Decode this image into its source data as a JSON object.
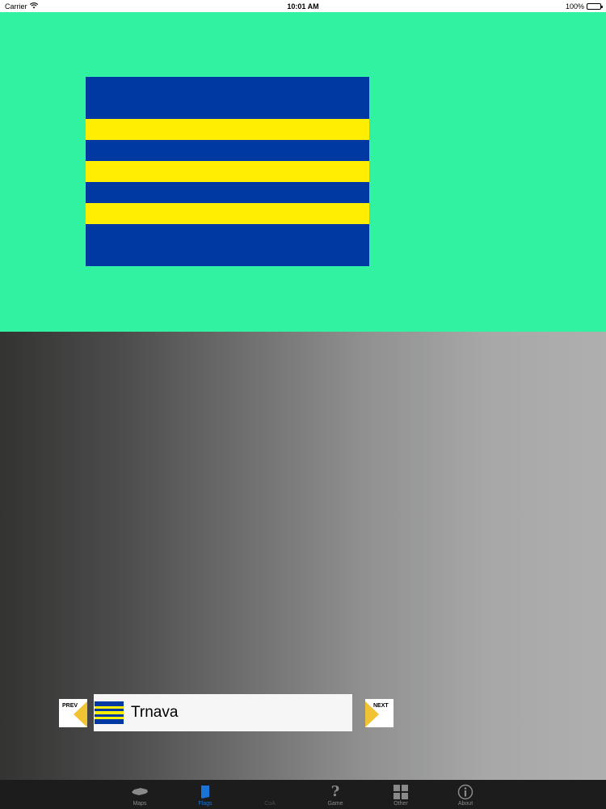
{
  "status_bar": {
    "carrier": "Carrier",
    "time": "10:01 AM",
    "battery": "100%"
  },
  "flag": {
    "stripes": [
      {
        "color": "#0039a1",
        "weight": 52
      },
      {
        "color": "#ffee00",
        "weight": 26
      },
      {
        "color": "#0039a1",
        "weight": 26
      },
      {
        "color": "#ffee00",
        "weight": 26
      },
      {
        "color": "#0039a1",
        "weight": 26
      },
      {
        "color": "#ffee00",
        "weight": 26
      },
      {
        "color": "#0039a1",
        "weight": 52
      }
    ]
  },
  "colors": {
    "stage_background": "#31f2a1",
    "arrow": "#f1c232",
    "tab_active": "#1a73d6"
  },
  "navigator": {
    "prev_label": "PREV",
    "next_label": "NEXT",
    "region_name": "Trnava"
  },
  "tabs": [
    {
      "id": "maps",
      "label": "Maps",
      "icon": "map-icon",
      "state": "normal"
    },
    {
      "id": "flags",
      "label": "Flags",
      "icon": "flag-icon",
      "state": "active"
    },
    {
      "id": "coa",
      "label": "CoA",
      "icon": "coat-of-arms-icon",
      "state": "disabled"
    },
    {
      "id": "game",
      "label": "Game",
      "icon": "question-icon",
      "state": "normal"
    },
    {
      "id": "other",
      "label": "Other",
      "icon": "grid-icon",
      "state": "normal"
    },
    {
      "id": "about",
      "label": "About",
      "icon": "info-icon",
      "state": "normal"
    }
  ]
}
